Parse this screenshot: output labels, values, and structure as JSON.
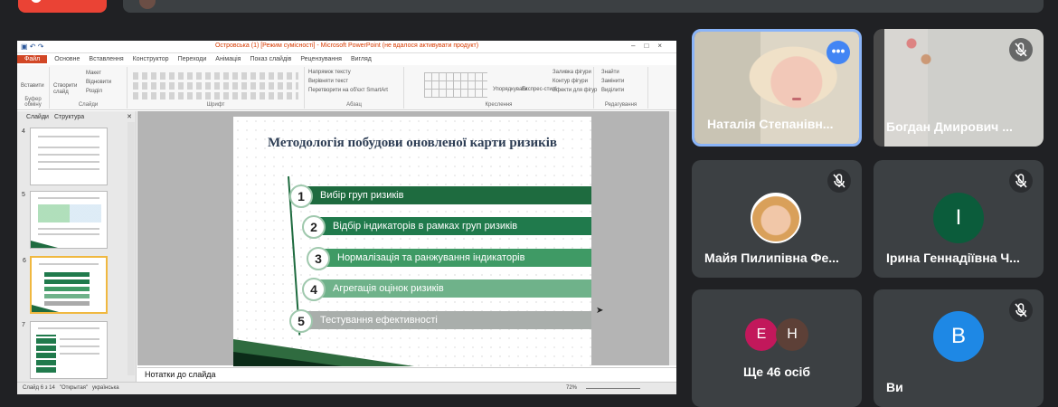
{
  "presentation": {
    "window_title": "Островська (1) [Режим сумісності] - Microsoft PowerPoint (не вдалося активувати продукт)",
    "tabs": [
      "Файл",
      "Основне",
      "Вставлення",
      "Конструктор",
      "Переходи",
      "Анімація",
      "Показ слайдів",
      "Рецензування",
      "Вигляд"
    ],
    "ribbon_groups": [
      "Буфер обміну",
      "Слайди",
      "Шрифт",
      "Абзац",
      "Креслення",
      "Редагування"
    ],
    "ribbon_labels": {
      "paste": "Вставити",
      "new_slide": "Створити слайд",
      "layout": "Макет",
      "reset": "Відновити",
      "section": "Розділ",
      "text_dir": "Напрямок тексту",
      "align_text": "Вирівняти текст",
      "smartart": "Перетворити на об'єкт SmartArt",
      "arrange": "Упорядкувати",
      "quick_styles": "Експрес-стилі",
      "shape_fill": "Заливка фігури",
      "shape_outline": "Контур фігури",
      "shape_effects": "Ефекти для фігур",
      "find": "Знайти",
      "replace": "Замінити",
      "select": "Виділити"
    },
    "panel_tabs": [
      "Слайди",
      "Структура"
    ],
    "slide_numbers": [
      "4",
      "5",
      "6",
      "7"
    ],
    "slide": {
      "title": "Методологія побудови оновленої карти ризиків",
      "steps": [
        {
          "num": "1",
          "label": "Вибір груп ризиків",
          "color": "#1e6b3f"
        },
        {
          "num": "2",
          "label": "Відбір індикаторів в рамках груп ризиків",
          "color": "#207a4c"
        },
        {
          "num": "3",
          "label": "Нормалізація та ранжування індикаторів",
          "color": "#3f9a65"
        },
        {
          "num": "4",
          "label": "Агрегація оцінок ризиків",
          "color": "#6fb28a"
        },
        {
          "num": "5",
          "label": "Тестування ефективності",
          "color": "#a9aeab"
        }
      ]
    },
    "notes_placeholder": "Нотатки до слайда",
    "status": {
      "slide_of": "Слайд 6 з 14",
      "theme": "\"Открытая\"",
      "language": "українська",
      "zoom": "72%"
    }
  },
  "participants": [
    {
      "name": "Наталія Степанівн...",
      "muted": false,
      "kind": "video-woman"
    },
    {
      "name": "Богдан Дмирович ...",
      "muted": true,
      "kind": "video-room"
    },
    {
      "name": "Майя Пилипівна Фе...",
      "muted": true,
      "kind": "photo"
    },
    {
      "name": "Ірина Геннадіївна Ч...",
      "muted": true,
      "kind": "letter",
      "letter": "І",
      "color": "#0b5c3b"
    },
    {
      "name": "",
      "muted": false,
      "kind": "others",
      "avatars": [
        {
          "letter": "Е",
          "color": "#c2185b"
        },
        {
          "letter": "Н",
          "color": "#5d4037"
        }
      ],
      "more": "Ще 46 осіб"
    },
    {
      "name": "Ви",
      "muted": true,
      "kind": "letter",
      "letter": "В",
      "color": "#1e88e5"
    }
  ]
}
